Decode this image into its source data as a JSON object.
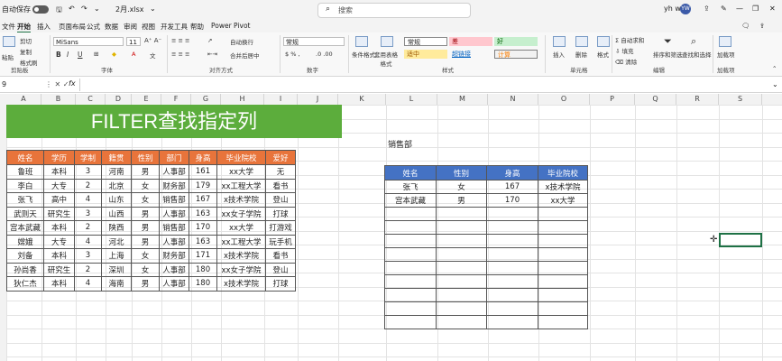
{
  "titlebar": {
    "autosave": "自动保存",
    "filename": "2月.xlsx",
    "search_placeholder": "搜索",
    "user": "yh w",
    "avatar": "YW"
  },
  "menu": [
    "文件",
    "开始",
    "插入",
    "页面布局",
    "公式",
    "数据",
    "审阅",
    "视图",
    "开发工具",
    "帮助",
    "Power Pivot"
  ],
  "ribbon": {
    "paste": "粘贴",
    "cut": "剪切",
    "copy": "复制",
    "format_painter": "格式刷",
    "clipboard": "剪贴板",
    "font_name": "MiSans",
    "font_size": "11",
    "font_group": "字体",
    "wrap": "自动换行",
    "merge": "合并后居中",
    "align_group": "对齐方式",
    "number_format": "常规",
    "number_group": "数字",
    "cond_format": "条件格式",
    "table_format": "套用表格格式",
    "styles": [
      "常规",
      "差",
      "好",
      "适中",
      "超链接",
      "计算"
    ],
    "styles_group": "样式",
    "insert": "插入",
    "delete": "删除",
    "format": "格式",
    "cells_group": "单元格",
    "autosum": "自动求和",
    "fill": "填充",
    "clear": "清除",
    "sort_filter": "排序和筛选",
    "find_select": "查找和选择",
    "edit_group": "编辑",
    "addins": "加载项",
    "addins_group": "加载项"
  },
  "formula_bar": {
    "namebox": "9",
    "fx": "fx"
  },
  "columns": [
    "A",
    "B",
    "C",
    "D",
    "E",
    "F",
    "G",
    "H",
    "I",
    "J",
    "K",
    "L",
    "M",
    "N",
    "O",
    "P",
    "Q",
    "R",
    "S"
  ],
  "banner_title": "FILTER查找指定列",
  "table1": {
    "headers": [
      "姓名",
      "学历",
      "学制",
      "籍贯",
      "性别",
      "部门",
      "身高",
      "毕业院校",
      "爱好"
    ],
    "rows": [
      [
        "鲁班",
        "本科",
        "3",
        "河南",
        "男",
        "人事部",
        "161",
        "xx大学",
        "无"
      ],
      [
        "李白",
        "大专",
        "2",
        "北京",
        "女",
        "财务部",
        "179",
        "xx工程大学",
        "看书"
      ],
      [
        "张飞",
        "高中",
        "4",
        "山东",
        "女",
        "销售部",
        "167",
        "x技术学院",
        "登山"
      ],
      [
        "武则天",
        "研究生",
        "3",
        "山西",
        "男",
        "人事部",
        "163",
        "xx女子学院",
        "打球"
      ],
      [
        "宫本武藏",
        "本科",
        "2",
        "陕西",
        "男",
        "销售部",
        "170",
        "xx大学",
        "打游戏"
      ],
      [
        "嫦娥",
        "大专",
        "4",
        "河北",
        "男",
        "人事部",
        "163",
        "xx工程大学",
        "玩手机"
      ],
      [
        "刘备",
        "本科",
        "3",
        "上海",
        "女",
        "财务部",
        "171",
        "x技术学院",
        "看书"
      ],
      [
        "孙尚香",
        "研究生",
        "2",
        "深圳",
        "女",
        "人事部",
        "180",
        "xx女子学院",
        "登山"
      ],
      [
        "狄仁杰",
        "本科",
        "4",
        "海南",
        "男",
        "人事部",
        "180",
        "x技术学院",
        "打球"
      ]
    ]
  },
  "dept_label": "销售部",
  "table2": {
    "headers": [
      "姓名",
      "性别",
      "身高",
      "毕业院校"
    ],
    "rows": [
      [
        "张飞",
        "女",
        "167",
        "x技术学院"
      ],
      [
        "宫本武藏",
        "男",
        "170",
        "xx大学"
      ]
    ],
    "empty_rows": 9
  }
}
